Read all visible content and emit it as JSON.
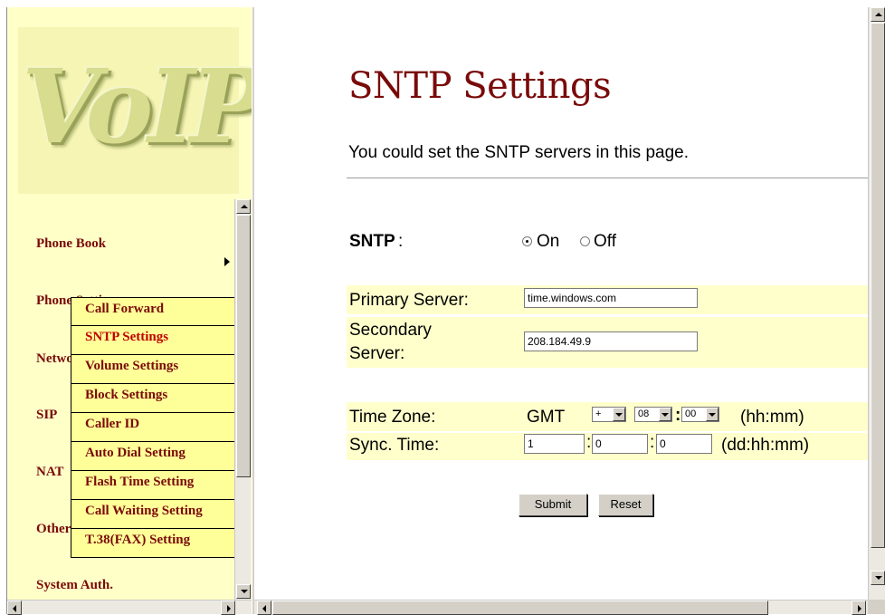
{
  "sidebar": {
    "logo_text": "VoIP",
    "nav_items": [
      "Phone Book",
      "Phone Settings",
      "Network",
      "SIP",
      "NAT",
      "Other",
      "System Auth."
    ],
    "submenu_items": [
      "Call Forward",
      "SNTP Settings",
      "Volume Settings",
      "Block Settings",
      "Caller ID",
      "Auto Dial Setting",
      "Flash Time Setting",
      "Call Waiting Setting",
      "T.38(FAX) Setting"
    ]
  },
  "page": {
    "title": "SNTP Settings",
    "description": "You could set the SNTP servers in this page."
  },
  "form": {
    "sntp_label": "SNTP",
    "sntp_colon": ":",
    "on_label": "On",
    "off_label": "Off",
    "sntp_selected": "On",
    "primary_label": "Primary Server:",
    "primary_value": "time.windows.com",
    "secondary_label_1": "Secondary",
    "secondary_label_2": "Server:",
    "secondary_value": "208.184.49.9",
    "timezone_label": "Time Zone:",
    "gmt_label": "GMT",
    "tz_sign": "+",
    "tz_hours": "08",
    "tz_minutes": "00",
    "tz_colon": ":",
    "tz_format": "(hh:mm)",
    "sync_label": "Sync. Time:",
    "sync_days": "1",
    "sync_hours": "0",
    "sync_minutes": "0",
    "sync_colon": ":",
    "sync_format": "(dd:hh:mm)",
    "submit_label": "Submit",
    "reset_label": "Reset"
  },
  "colors": {
    "title": "#7a0a0a",
    "sidebar_bg": "#ffffc8",
    "submenu_bg": "#ffff99",
    "row_bg": "#ffffcc",
    "active_menu": "#c00000"
  }
}
